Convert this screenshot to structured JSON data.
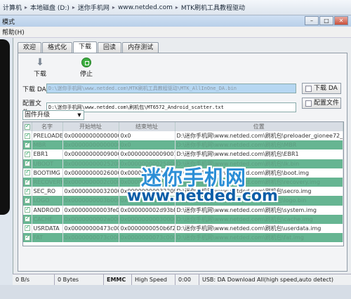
{
  "addressbar": {
    "crumbs": [
      "计算机",
      "本地磁盘 (D:)",
      "迷你手机网",
      "www.netded.com",
      "MTK刷机工具教程驱动"
    ]
  },
  "window": {
    "title": "模式"
  },
  "menubar": {
    "items": [
      "帮助(H)"
    ]
  },
  "tabs": [
    "欢迎",
    "格式化",
    "下载",
    "回读",
    "内存测试"
  ],
  "active_tab": "下载",
  "toolbar": {
    "download_label": "下载",
    "stop_label": "停止"
  },
  "da": {
    "label": "下载 DA",
    "path": "D:\\迷你手机网\\www.netded.com\\MTK刷机工具教程驱动\\MTK_AllInOne_DA.bin",
    "button": "下载 DA"
  },
  "scatter": {
    "label": "配置文件",
    "path": "D:\\迷你手机网\\www.netded.com\\刷机包\\MT6572_Android_scatter.txt",
    "button": "配置文件"
  },
  "mode_select": {
    "value": "固件升级"
  },
  "table": {
    "headers": [
      "名字",
      "开始地址",
      "结束地址",
      "位置"
    ],
    "rows": [
      {
        "name": "PRELOADER",
        "start": "0x0000000000000000",
        "end": "0x0",
        "loc": "D:\\迷你手机网\\www.netded.com\\刷机包\\preloader_gionee72_...",
        "checked": true,
        "style": "white"
      },
      {
        "name": "MBR",
        "start": "0x0000000000000000",
        "end": "0x0",
        "loc": "D:\\迷你手机网\\www.netded.com\\刷机包\\MBR",
        "checked": true,
        "style": "green"
      },
      {
        "name": "EBR1",
        "start": "0x0000000000900000",
        "end": "0x00000000009001ff",
        "loc": "D:\\迷你手机网\\www.netded.com\\刷机包\\EBR1",
        "checked": true,
        "style": "white"
      },
      {
        "name": "UBOOT",
        "start": "0x0000000002520000",
        "end": "0x0000000002580000",
        "loc": "D:\\迷你手机网\\www.netded.com\\刷机包\\lk.bin",
        "checked": true,
        "style": "green"
      },
      {
        "name": "BOOTIMG",
        "start": "0x0000000002600000",
        "end": "0x0000000002a7ffff",
        "loc": "D:\\迷你手机网\\www.netded.com\\刷机包\\boot.img",
        "checked": true,
        "style": "white"
      },
      {
        "name": "RECOVERY",
        "start": "0x0000000002c00000",
        "end": "0x0000000003100000",
        "loc": "D:\\迷你手机网\\www.netded.com\\刷机包\\recovery.img",
        "checked": true,
        "style": "green"
      },
      {
        "name": "SEC_RO",
        "start": "0x0000000003200000",
        "end": "0x0000000003220fff",
        "loc": "D:\\迷你手机网\\www.netded.com\\刷机包\\secro.img",
        "checked": true,
        "style": "white"
      },
      {
        "name": "LOGO",
        "start": "0x0000000003b00000",
        "end": "0x0000000003c00000",
        "loc": "D:\\迷你手机网\\www.netded.com\\刷机包\\logo.bin",
        "checked": true,
        "style": "green"
      },
      {
        "name": "ANDROID",
        "start": "0x00000000003fe0000",
        "end": "0x000000002d93bbb7",
        "loc": "D:\\迷你手机网\\www.netded.com\\刷机包\\system.img",
        "checked": true,
        "style": "white"
      },
      {
        "name": "CACHE",
        "start": "0x0000000002a00000",
        "end": "0x0000000003000000",
        "loc": "D:\\迷你手机网\\www.netded.com\\刷机包\\cache.img",
        "checked": true,
        "style": "green"
      },
      {
        "name": "USRDATA",
        "start": "0x00000000473c0000",
        "end": "0x0000000050b6f24f",
        "loc": "D:\\迷你手机网\\www.netded.com\\刷机包\\userdata.img",
        "checked": true,
        "style": "white"
      },
      {
        "name": "FAT",
        "start": "0x0000000073c00000",
        "end": "0x0000000073c00000",
        "loc": "D:\\迷你手机网\\www.netded.com\\刷机包\\fat.img",
        "checked": true,
        "style": "green"
      }
    ]
  },
  "watermark": {
    "line1": "迷你手机网",
    "line2": "www.netded.com"
  },
  "statusbar": {
    "speed": "0 B/s",
    "bytes": "0 Bytes",
    "storage": "EMMC",
    "mode": "High Speed",
    "time": "0:00",
    "info": "USB: DA Download All(high speed,auto detect)"
  }
}
